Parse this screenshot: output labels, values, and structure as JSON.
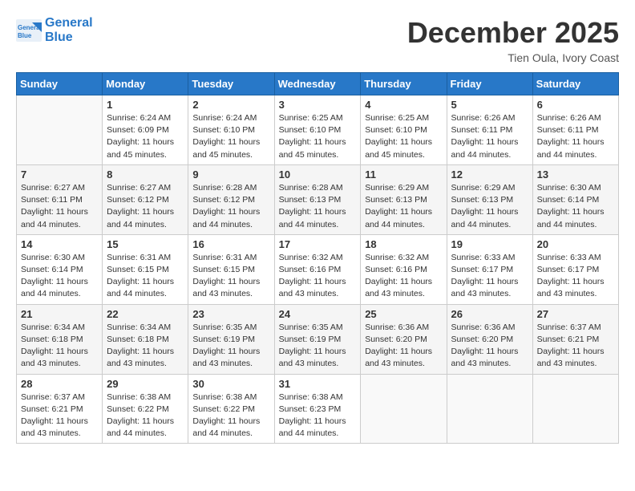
{
  "header": {
    "logo_line1": "General",
    "logo_line2": "Blue",
    "month": "December 2025",
    "location": "Tien Oula, Ivory Coast"
  },
  "weekdays": [
    "Sunday",
    "Monday",
    "Tuesday",
    "Wednesday",
    "Thursday",
    "Friday",
    "Saturday"
  ],
  "weeks": [
    [
      {
        "day": "",
        "info": ""
      },
      {
        "day": "1",
        "info": "Sunrise: 6:24 AM\nSunset: 6:09 PM\nDaylight: 11 hours\nand 45 minutes."
      },
      {
        "day": "2",
        "info": "Sunrise: 6:24 AM\nSunset: 6:10 PM\nDaylight: 11 hours\nand 45 minutes."
      },
      {
        "day": "3",
        "info": "Sunrise: 6:25 AM\nSunset: 6:10 PM\nDaylight: 11 hours\nand 45 minutes."
      },
      {
        "day": "4",
        "info": "Sunrise: 6:25 AM\nSunset: 6:10 PM\nDaylight: 11 hours\nand 45 minutes."
      },
      {
        "day": "5",
        "info": "Sunrise: 6:26 AM\nSunset: 6:11 PM\nDaylight: 11 hours\nand 44 minutes."
      },
      {
        "day": "6",
        "info": "Sunrise: 6:26 AM\nSunset: 6:11 PM\nDaylight: 11 hours\nand 44 minutes."
      }
    ],
    [
      {
        "day": "7",
        "info": "Sunrise: 6:27 AM\nSunset: 6:11 PM\nDaylight: 11 hours\nand 44 minutes."
      },
      {
        "day": "8",
        "info": "Sunrise: 6:27 AM\nSunset: 6:12 PM\nDaylight: 11 hours\nand 44 minutes."
      },
      {
        "day": "9",
        "info": "Sunrise: 6:28 AM\nSunset: 6:12 PM\nDaylight: 11 hours\nand 44 minutes."
      },
      {
        "day": "10",
        "info": "Sunrise: 6:28 AM\nSunset: 6:13 PM\nDaylight: 11 hours\nand 44 minutes."
      },
      {
        "day": "11",
        "info": "Sunrise: 6:29 AM\nSunset: 6:13 PM\nDaylight: 11 hours\nand 44 minutes."
      },
      {
        "day": "12",
        "info": "Sunrise: 6:29 AM\nSunset: 6:13 PM\nDaylight: 11 hours\nand 44 minutes."
      },
      {
        "day": "13",
        "info": "Sunrise: 6:30 AM\nSunset: 6:14 PM\nDaylight: 11 hours\nand 44 minutes."
      }
    ],
    [
      {
        "day": "14",
        "info": "Sunrise: 6:30 AM\nSunset: 6:14 PM\nDaylight: 11 hours\nand 44 minutes."
      },
      {
        "day": "15",
        "info": "Sunrise: 6:31 AM\nSunset: 6:15 PM\nDaylight: 11 hours\nand 44 minutes."
      },
      {
        "day": "16",
        "info": "Sunrise: 6:31 AM\nSunset: 6:15 PM\nDaylight: 11 hours\nand 43 minutes."
      },
      {
        "day": "17",
        "info": "Sunrise: 6:32 AM\nSunset: 6:16 PM\nDaylight: 11 hours\nand 43 minutes."
      },
      {
        "day": "18",
        "info": "Sunrise: 6:32 AM\nSunset: 6:16 PM\nDaylight: 11 hours\nand 43 minutes."
      },
      {
        "day": "19",
        "info": "Sunrise: 6:33 AM\nSunset: 6:17 PM\nDaylight: 11 hours\nand 43 minutes."
      },
      {
        "day": "20",
        "info": "Sunrise: 6:33 AM\nSunset: 6:17 PM\nDaylight: 11 hours\nand 43 minutes."
      }
    ],
    [
      {
        "day": "21",
        "info": "Sunrise: 6:34 AM\nSunset: 6:18 PM\nDaylight: 11 hours\nand 43 minutes."
      },
      {
        "day": "22",
        "info": "Sunrise: 6:34 AM\nSunset: 6:18 PM\nDaylight: 11 hours\nand 43 minutes."
      },
      {
        "day": "23",
        "info": "Sunrise: 6:35 AM\nSunset: 6:19 PM\nDaylight: 11 hours\nand 43 minutes."
      },
      {
        "day": "24",
        "info": "Sunrise: 6:35 AM\nSunset: 6:19 PM\nDaylight: 11 hours\nand 43 minutes."
      },
      {
        "day": "25",
        "info": "Sunrise: 6:36 AM\nSunset: 6:20 PM\nDaylight: 11 hours\nand 43 minutes."
      },
      {
        "day": "26",
        "info": "Sunrise: 6:36 AM\nSunset: 6:20 PM\nDaylight: 11 hours\nand 43 minutes."
      },
      {
        "day": "27",
        "info": "Sunrise: 6:37 AM\nSunset: 6:21 PM\nDaylight: 11 hours\nand 43 minutes."
      }
    ],
    [
      {
        "day": "28",
        "info": "Sunrise: 6:37 AM\nSunset: 6:21 PM\nDaylight: 11 hours\nand 43 minutes."
      },
      {
        "day": "29",
        "info": "Sunrise: 6:38 AM\nSunset: 6:22 PM\nDaylight: 11 hours\nand 44 minutes."
      },
      {
        "day": "30",
        "info": "Sunrise: 6:38 AM\nSunset: 6:22 PM\nDaylight: 11 hours\nand 44 minutes."
      },
      {
        "day": "31",
        "info": "Sunrise: 6:38 AM\nSunset: 6:23 PM\nDaylight: 11 hours\nand 44 minutes."
      },
      {
        "day": "",
        "info": ""
      },
      {
        "day": "",
        "info": ""
      },
      {
        "day": "",
        "info": ""
      }
    ]
  ]
}
